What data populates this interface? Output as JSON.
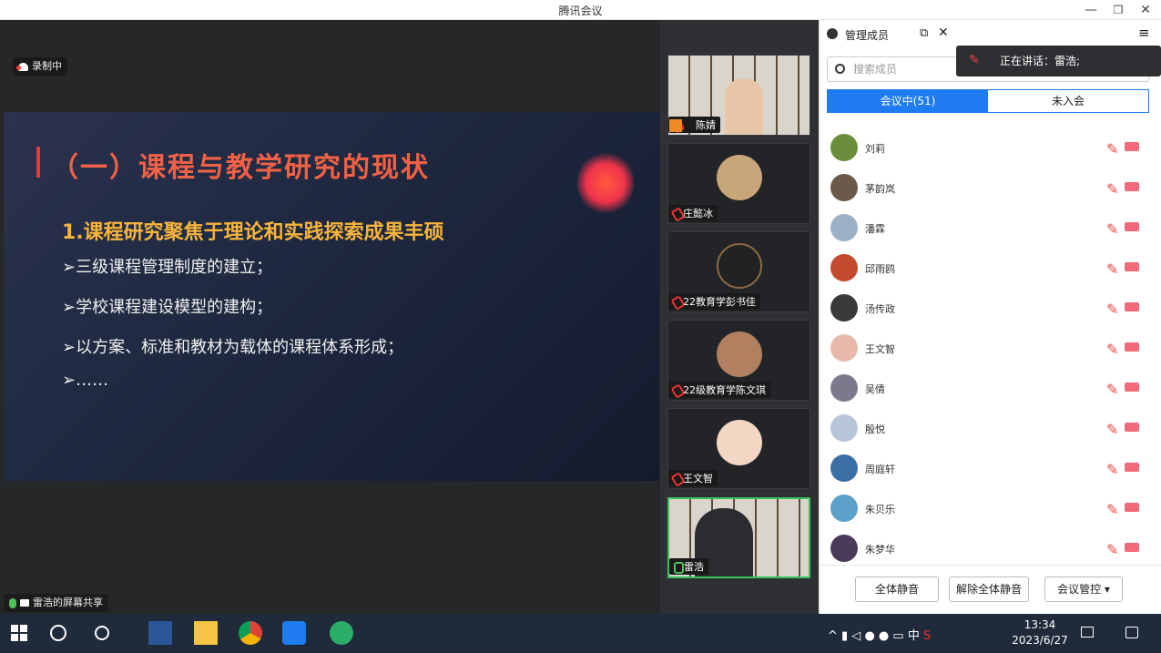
{
  "window": {
    "title": "腾讯会议",
    "min": "—",
    "restore": "ꟷ",
    "close": "✕"
  },
  "stage": {
    "recording": "录制中",
    "share_label": "雷浩的屏幕共享"
  },
  "slide": {
    "heading": "（一）课程与教学研究的现状",
    "subheading": "1.课程研究聚焦于理论和实践探索成果丰硕",
    "bullets": [
      "➢三级课程管理制度的建立；",
      "➢学校课程建设模型的建构；",
      "➢以方案、标准和教材为载体的课程体系形成；",
      "➢……"
    ]
  },
  "video_tiles": [
    {
      "name": "陈婧"
    },
    {
      "name": "庄懿冰"
    },
    {
      "name": "22教育学彭书佳"
    },
    {
      "name": "22级教育学陈文琪"
    },
    {
      "name": "王文智"
    },
    {
      "name": "雷浩"
    }
  ],
  "panel": {
    "title": "管理成员",
    "search_placeholder": "搜索成员",
    "tab_in": "会议中(51)",
    "tab_out": "未入会",
    "speaking": "正在讲话：雷浩;",
    "members": [
      "刘莉",
      "茅韵岚",
      "潘霖",
      "邱雨鸥",
      "汤传政",
      "王文智",
      "吴倩",
      "殷悦",
      "周庭轩",
      "朱贝乐",
      "朱梦华"
    ],
    "mute_all": "全体静音",
    "unmute_all": "解除全体静音",
    "controls": "会议管控 ▾"
  },
  "taskbar": {
    "time": "13:34",
    "date": "2023/6/27",
    "ime": "中"
  },
  "colors": {
    "accent": "#1e7cf0",
    "recording": "#ff3b30",
    "active_tile": "#39c25a"
  }
}
